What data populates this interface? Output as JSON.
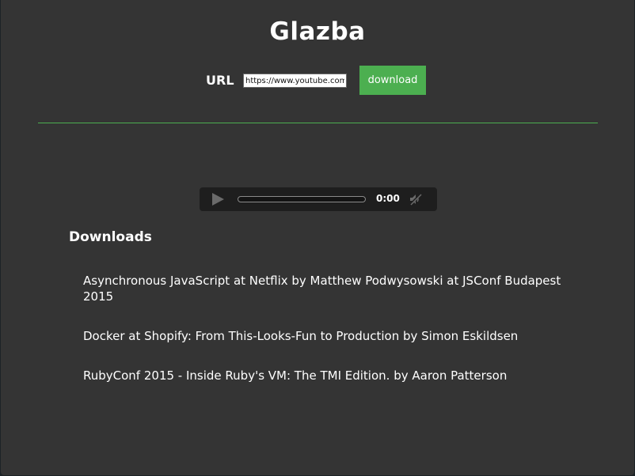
{
  "app": {
    "title": "Glazba"
  },
  "form": {
    "url_label": "URL",
    "url_value": "https://www.youtube.com",
    "download_label": "download"
  },
  "player": {
    "time": "0:00",
    "icons": [
      "play-icon",
      "mute-icon"
    ]
  },
  "downloads": {
    "heading": "Downloads",
    "items": [
      {
        "title": "Asynchronous JavaScript at Netflix by Matthew Podwysowski at JSConf Budapest 2015"
      },
      {
        "title": "Docker at Shopify: From This-Looks-Fun to Production by Simon Eskildsen"
      },
      {
        "title": "RubyConf 2015 - Inside Ruby's VM: The TMI Edition. by Aaron Patterson"
      }
    ]
  },
  "colors": {
    "background": "#343434",
    "accent": "#4caf50",
    "player_bg": "#1e1e1e",
    "text": "#ffffff"
  }
}
